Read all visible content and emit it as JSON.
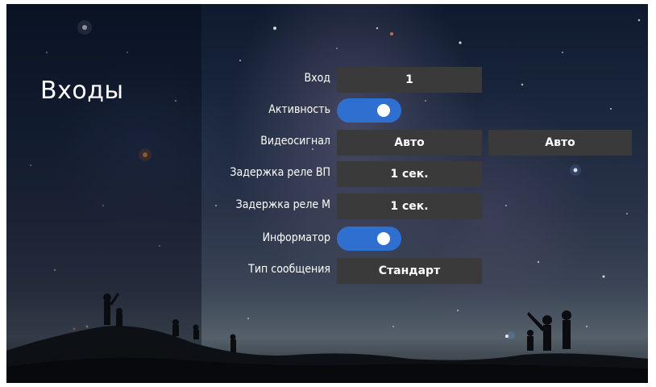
{
  "page": {
    "title": "Входы"
  },
  "settings": {
    "input": {
      "label": "Вход",
      "value": "1"
    },
    "activity": {
      "label": "Активность",
      "enabled": true
    },
    "video_signal": {
      "label": "Видеосигнал",
      "value_1": "Авто",
      "value_2": "Авто"
    },
    "relay_delay_vp": {
      "label": "Задержка реле ВП",
      "value": "1 сек."
    },
    "relay_delay_m": {
      "label": "Задержка реле М",
      "value": "1 сек."
    },
    "informer": {
      "label": "Информатор",
      "enabled": true
    },
    "message_type": {
      "label": "Тип сообщения",
      "value": "Стандарт"
    }
  },
  "colors": {
    "field_bg": "#3a3a3a",
    "toggle_on": "#2f6fd0",
    "text": "#ffffff"
  }
}
